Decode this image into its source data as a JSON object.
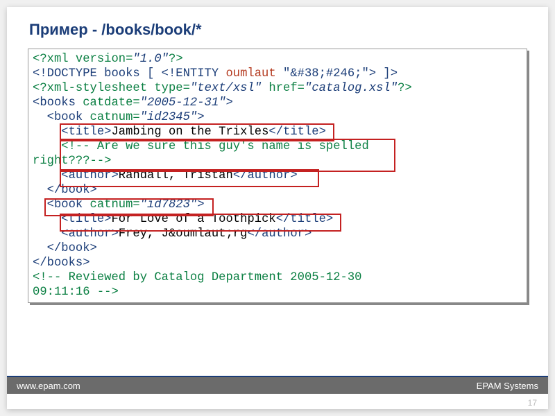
{
  "slide": {
    "title": "Пример - /books/book/*",
    "page_number": "17"
  },
  "footer": {
    "url": "www.epam.com",
    "company": "EPAM Systems"
  },
  "code": {
    "l1a": "<?xml ",
    "l1b": "version",
    "l1c": "=",
    "l1d": "\"1.0\"",
    "l1e": "?>",
    "l2a": "<!DOCTYPE books [ <!ENTITY ",
    "l2b": "oumlaut ",
    "l2c": "\"&#38;#246;\"",
    "l2d": "> ]>",
    "l3a": "<?xml-stylesheet ",
    "l3b": "type",
    "l3c": "=",
    "l3d": "\"text/xsl\"",
    "l3e": " href",
    "l3f": "=",
    "l3g": "\"catalog.xsl\"",
    "l3h": "?>",
    "l4a": "<books ",
    "l4b": "catdate",
    "l4c": "=",
    "l4d": "\"2005-12-31\"",
    "l4e": ">",
    "l5a": "  <book ",
    "l5b": "catnum",
    "l5c": "=",
    "l5d": "\"id2345\"",
    "l5e": ">",
    "l6a": "    <title>",
    "l6b": "Jambing on the Trixles",
    "l6c": "</title>",
    "l7": "    <!-- Are we sure this guy's name is spelled",
    "l8": "right???-->",
    "l9a": "    <author>",
    "l9b": "Randall, Tristan",
    "l9c": "</author>",
    "l10": "  </book>",
    "l11a": "  <book ",
    "l11b": "catnum",
    "l11c": "=",
    "l11d": "\"id7823\"",
    "l11e": ">",
    "l12a": "    <title>",
    "l12b": "For Love of a Toothpick",
    "l12c": "</title>",
    "l13a": "    <author>",
    "l13b": "Frey, J&oumlaut;rg",
    "l13c": "</author>",
    "l14": "  </book>",
    "l15": "</books>",
    "l16": "<!-- Reviewed by Catalog Department 2005-12-30",
    "l17": "09:11:16 -->"
  },
  "chart_data": {
    "type": "table",
    "title": "XML books catalog sample",
    "xpath_example": "/books/book/*",
    "catdate": "2005-12-31",
    "doctype_entity": {
      "name": "oumlaut",
      "value": "&#246;"
    },
    "stylesheet": {
      "type": "text/xsl",
      "href": "catalog.xsl"
    },
    "books": [
      {
        "catnum": "id2345",
        "title": "Jambing on the Trixles",
        "author": "Randall, Tristan",
        "comment": "Are we sure this guy's name is spelled right???"
      },
      {
        "catnum": "id7823",
        "title": "For Love of a Toothpick",
        "author": "Frey, Jörg"
      }
    ],
    "trailing_comment": "Reviewed by Catalog Department 2005-12-30 09:11:16",
    "highlighted_nodes": [
      "book[1]/title",
      "book[1]/comment()",
      "book[1]/author",
      "book[2]",
      "book[2]/title"
    ]
  }
}
